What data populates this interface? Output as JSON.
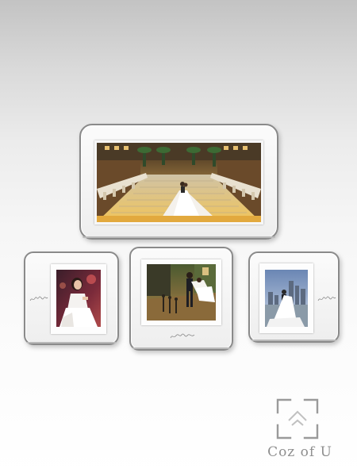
{
  "brand": {
    "name": "Coz of U",
    "logo_icon": "interlocking-bracket-logo-icon"
  },
  "frames": [
    {
      "id": "frame-large-top",
      "photo": "bride-and-groom-on-palace-staircase"
    },
    {
      "id": "frame-small-left",
      "photo": "bride-portrait-in-white-dress"
    },
    {
      "id": "frame-medium-center",
      "photo": "groom-lifting-bride-on-street"
    },
    {
      "id": "frame-small-right",
      "photo": "bride-by-city-skyline"
    }
  ],
  "colors": {
    "frame_border": "#8a8a8a",
    "frame_face": "#f4f4f4",
    "background_top": "#c3c3c3",
    "background_bottom": "#ffffff",
    "brand_text": "#8f8f8f"
  }
}
